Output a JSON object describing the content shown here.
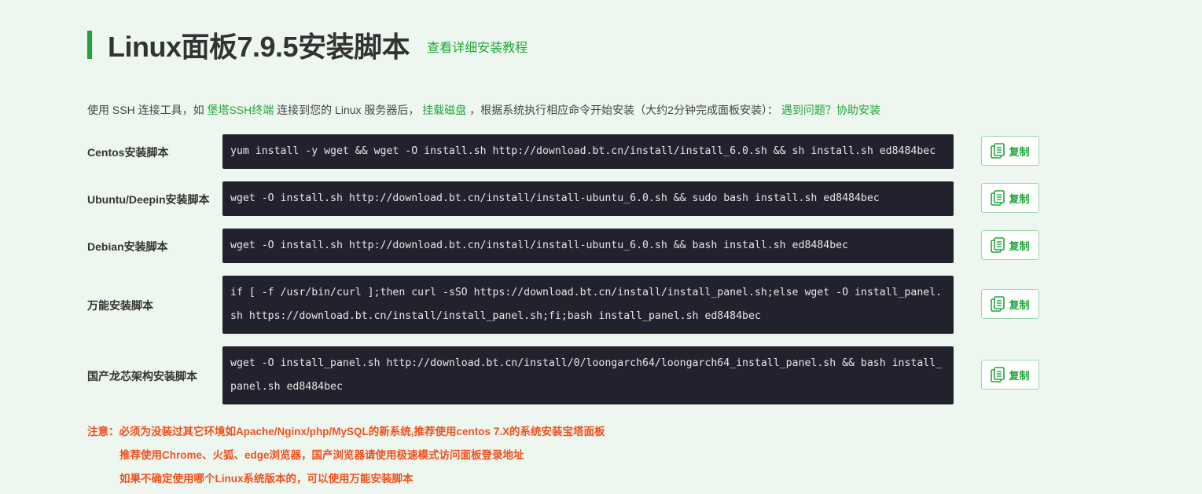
{
  "title": "Linux面板7.9.5安装脚本",
  "tutorial_link": "查看详细安装教程",
  "intro": {
    "part1": "使用 SSH 连接工具，如 ",
    "link_ssh": "堡塔SSH终端",
    "part2": " 连接到您的 Linux 服务器后， ",
    "link_disk": "挂载磁盘",
    "part3": " ，根据系统执行相应命令开始安装（大约2分钟完成面板安装）： ",
    "link_help": "遇到问题？协助安装"
  },
  "scripts": [
    {
      "label": "Centos安装脚本",
      "command": "yum install -y wget && wget -O install.sh http://download.bt.cn/install/install_6.0.sh && sh install.sh ed8484bec",
      "copy": "复制"
    },
    {
      "label": "Ubuntu/Deepin安装脚本",
      "command": "wget -O install.sh http://download.bt.cn/install/install-ubuntu_6.0.sh && sudo bash install.sh ed8484bec",
      "copy": "复制"
    },
    {
      "label": "Debian安装脚本",
      "command": "wget -O install.sh http://download.bt.cn/install/install-ubuntu_6.0.sh && bash install.sh ed8484bec",
      "copy": "复制"
    },
    {
      "label": "万能安装脚本",
      "command": "if [ -f /usr/bin/curl ];then curl -sSO https://download.bt.cn/install/install_panel.sh;else wget -O install_panel.sh https://download.bt.cn/install/install_panel.sh;fi;bash install_panel.sh ed8484bec",
      "copy": "复制"
    },
    {
      "label": "国产龙芯架构安装脚本",
      "command": "wget -O install_panel.sh http://download.bt.cn/install/0/loongarch64/loongarch64_install_panel.sh && bash install_panel.sh ed8484bec",
      "copy": "复制"
    }
  ],
  "notice": {
    "line1": "注意：必须为没装过其它环境如Apache/Nginx/php/MySQL的新系统,推荐使用centos 7.X的系统安装宝塔面板",
    "line2": "推荐使用Chrome、火狐、edge浏览器，国产浏览器请使用极速模式访问面板登录地址",
    "line3": "如果不确定使用哪个Linux系统版本的，可以使用万能安装脚本"
  },
  "colors": {
    "accent": "#20a53a",
    "code_bg": "#22222f",
    "warning": "#f0501e",
    "page_bg": "#eef7ef"
  },
  "icons": {
    "copy": "clipboard-icon"
  }
}
